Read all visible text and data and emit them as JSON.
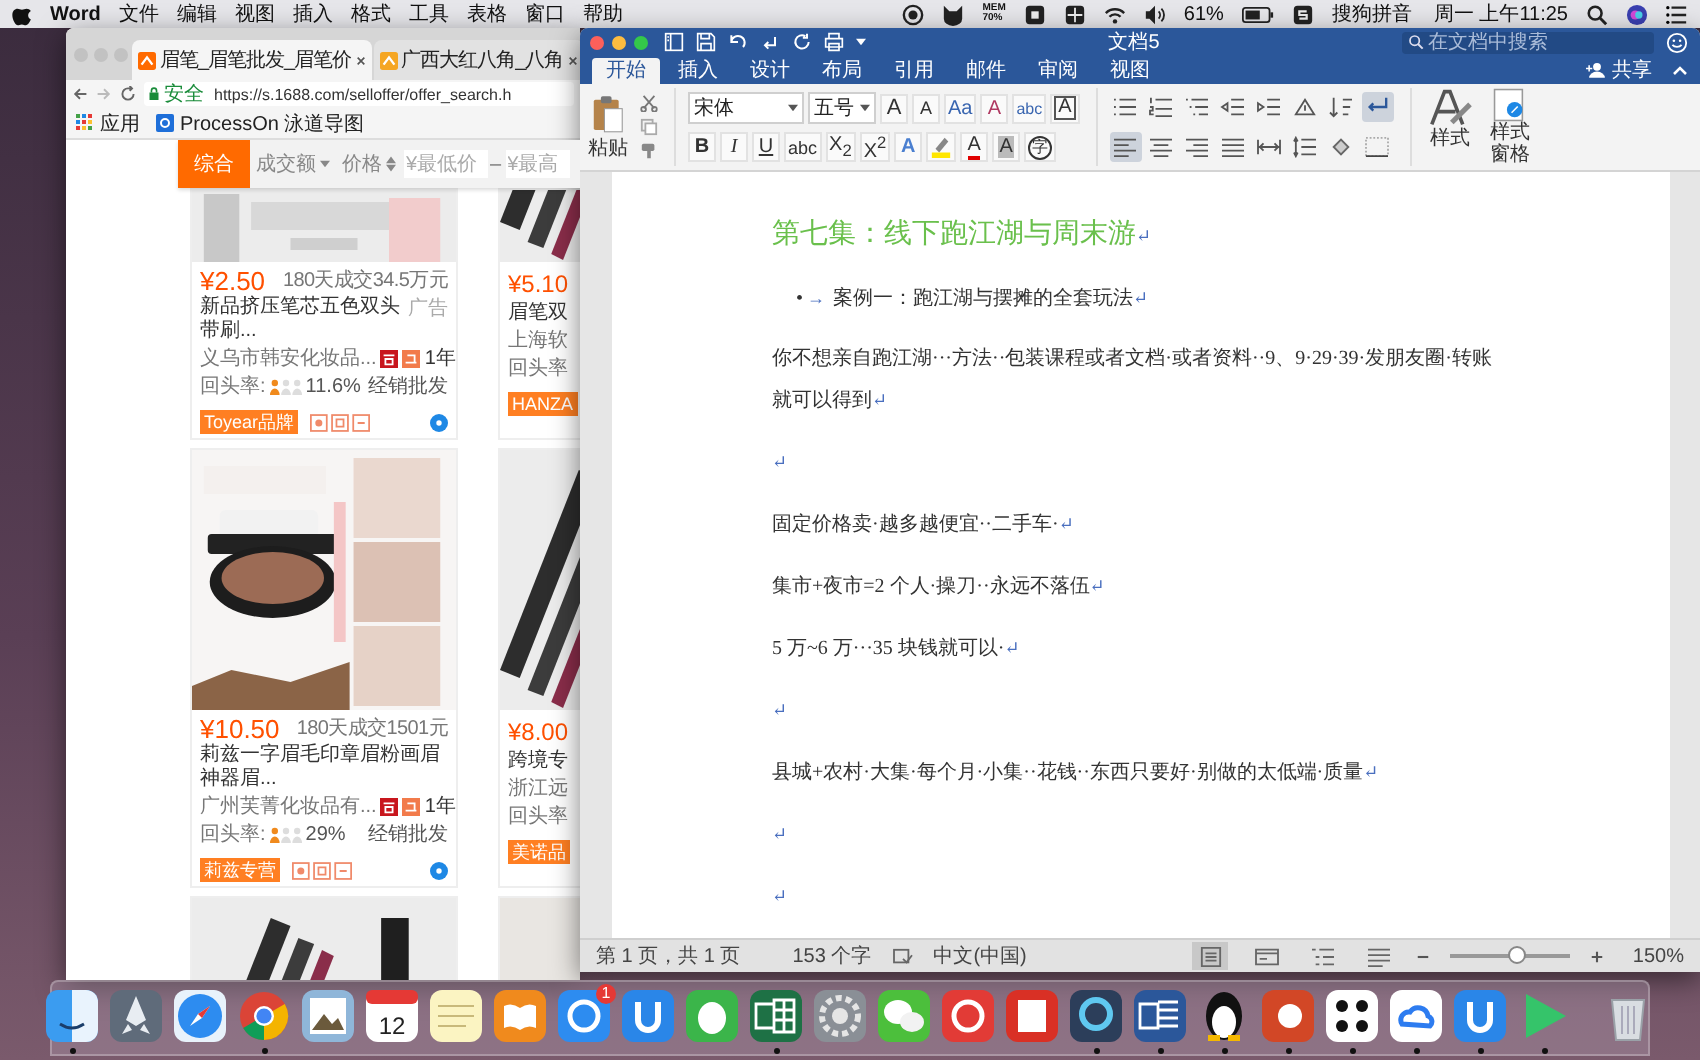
{
  "menubar": {
    "app": "Word",
    "menus": [
      "文件",
      "编辑",
      "视图",
      "插入",
      "格式",
      "工具",
      "表格",
      "窗口",
      "帮助"
    ],
    "memory_label": "MEM",
    "memory_value": "70%",
    "battery": "61%",
    "input_method": "搜狗拼音",
    "clock": "周一 上午11:25"
  },
  "browser": {
    "tabs": [
      {
        "title": "眉笔_眉笔批发_眉笔价",
        "selected": true
      },
      {
        "title": "广西大红八角_八角",
        "selected": false
      }
    ],
    "secure_label": "安全",
    "url": "https://s.1688.com/selloffer/offer_search.h",
    "bookmarks": [
      {
        "kind": "apps",
        "label": "应用"
      },
      {
        "kind": "site",
        "label": "ProcessOn 泳道导图"
      }
    ],
    "sort_options": [
      {
        "kind": "plain",
        "label": "综合",
        "selected": true
      },
      {
        "kind": "dropdown",
        "label": "成交额",
        "selected": false
      },
      {
        "kind": "toggle",
        "label": "价格",
        "selected": false
      }
    ],
    "price_min_placeholder": "¥最低价",
    "price_separator": "–",
    "price_max_placeholder": "¥最高",
    "products": [
      {
        "kind": "listing",
        "price": "¥2.50",
        "sales": "180天成交34.5万元",
        "title": "新品挤压笔芯五色双头带刷...",
        "ad": "广告",
        "company": "义乌市韩安化妆品...",
        "years": "1年",
        "repeat_label": "回头率:",
        "repeat_rate": "11.6%",
        "trade": "经销批发",
        "brand": "Toyear品牌"
      },
      {
        "kind": "partial",
        "price": "¥5.10",
        "title": "眉笔双",
        "company": "上海软",
        "repeat_label": "回头率",
        "brand": "HANZA"
      },
      {
        "kind": "listing",
        "price": "¥10.50",
        "sales": "180天成交1501元",
        "title": "莉兹一字眉毛印章眉粉画眉神器眉...",
        "company": "广州芙菁化妆品有...",
        "years": "1年",
        "repeat_label": "回头率:",
        "repeat_rate": "29%",
        "trade": "经销批发",
        "brand": "莉兹专营"
      },
      {
        "kind": "partial",
        "price": "¥8.00",
        "title": "跨境专",
        "company": "浙江远",
        "repeat_label": "回头率",
        "brand": "美诺品"
      },
      {
        "kind": "picture"
      },
      {
        "kind": "picture"
      }
    ]
  },
  "word": {
    "title": "文档5",
    "search_placeholder": "在文档中搜索",
    "tabs": [
      {
        "label": "开始",
        "selected": true
      },
      {
        "label": "插入",
        "selected": false
      },
      {
        "label": "设计",
        "selected": false
      },
      {
        "label": "布局",
        "selected": false
      },
      {
        "label": "引用",
        "selected": false
      },
      {
        "label": "邮件",
        "selected": false
      },
      {
        "label": "审阅",
        "selected": false
      },
      {
        "label": "视图",
        "selected": false
      }
    ],
    "share": "共享",
    "ribbon": {
      "paste": "粘贴",
      "font": "宋体",
      "size": "五号",
      "font_buttons": [
        {
          "kind": "grow",
          "label": "A"
        },
        {
          "kind": "shrink",
          "label": "A"
        },
        {
          "kind": "case",
          "label": "Aa"
        },
        {
          "kind": "clear",
          "label": "A"
        },
        {
          "kind": "phonetic",
          "label": "abc"
        },
        {
          "kind": "boxed",
          "label": "A"
        }
      ],
      "format_buttons": [
        {
          "kind": "bold",
          "label": "B"
        },
        {
          "kind": "italic",
          "label": "I"
        },
        {
          "kind": "underline",
          "label": "U"
        },
        {
          "kind": "strike",
          "label": "abc"
        },
        {
          "kind": "subscript",
          "label": "X$_{2}$"
        },
        {
          "kind": "superscript",
          "label": "X$^{2}$"
        },
        {
          "kind": "effects",
          "label": "A"
        },
        {
          "kind": "highlight"
        },
        {
          "kind": "color",
          "label": "A"
        },
        {
          "kind": "shade",
          "label": "A"
        },
        {
          "kind": "enclose",
          "label": "字"
        }
      ],
      "show_marks": true,
      "alignments": [
        {
          "kind": "left",
          "selected": true
        },
        {
          "kind": "center",
          "selected": false
        },
        {
          "kind": "right",
          "selected": false
        },
        {
          "kind": "justify",
          "selected": false
        },
        {
          "kind": "distribute",
          "selected": false
        }
      ],
      "styles": "样式",
      "styles_pane": "样式窗格"
    },
    "paragraphs": [
      {
        "kind": "heading",
        "text": "第七集：线下跑江湖与周末游",
        "mark": "↵"
      },
      {
        "kind": "bullet",
        "bullet": "•",
        "tab": "→",
        "text": "案例一：跑江湖与摆摊的全套玩法",
        "mark": "↵"
      },
      {
        "kind": "body",
        "text": "你不想亲自跑江湖···方法··包装课程或者文档·或者资料··9、9·29·39·发朋友圈·转账就可以得到",
        "mark": "↵"
      },
      {
        "kind": "empty",
        "mark": "↵"
      },
      {
        "kind": "body",
        "text": "固定价格卖·越多越便宜··二手车·",
        "mark": "↵"
      },
      {
        "kind": "body",
        "text": "集市+夜市=2 个人·操刀··永远不落伍",
        "mark": "↵"
      },
      {
        "kind": "body",
        "text": "5 万~6 万···35 块钱就可以·",
        "mark": "↵"
      },
      {
        "kind": "empty",
        "mark": "↵"
      },
      {
        "kind": "body",
        "text": "县城+农村·大集·每个月·小集··花钱··东西只要好·别做的太低端·质量",
        "mark": "↵"
      },
      {
        "kind": "empty",
        "mark": "↵"
      },
      {
        "kind": "empty",
        "mark": "↵"
      }
    ],
    "status": {
      "page": "第 1 页，共 1 页",
      "words": "153 个字",
      "language": "中文(中国)",
      "views": [
        {
          "kind": "print",
          "selected": true
        },
        {
          "kind": "web",
          "selected": false
        },
        {
          "kind": "outline",
          "selected": false
        },
        {
          "kind": "draft",
          "selected": false
        }
      ],
      "zoom_slider": {
        "level": 0.55
      },
      "zoom": "150%"
    }
  },
  "dock": {
    "badge": "1",
    "calendar_day": "12",
    "apps": [
      {
        "kind": "finder",
        "running": true
      },
      {
        "kind": "launchpad",
        "running": false
      },
      {
        "kind": "safari",
        "running": false
      },
      {
        "kind": "chrome",
        "running": true
      },
      {
        "kind": "preview",
        "running": false
      },
      {
        "kind": "calendar",
        "running": false
      },
      {
        "kind": "notes",
        "running": false
      },
      {
        "kind": "books",
        "running": false
      },
      {
        "kind": "appstore",
        "running": false
      },
      {
        "kind": "ushape",
        "running": false
      },
      {
        "kind": "evernote",
        "running": false
      },
      {
        "kind": "excel",
        "running": true
      },
      {
        "kind": "prefs",
        "running": false
      },
      {
        "kind": "wechat",
        "running": false
      },
      {
        "kind": "music",
        "running": false
      },
      {
        "kind": "pdf",
        "running": false
      },
      {
        "kind": "quicktime",
        "running": true
      },
      {
        "kind": "word",
        "running": true
      },
      {
        "kind": "qq",
        "running": true
      },
      {
        "kind": "ppt",
        "running": true
      },
      {
        "kind": "dots",
        "running": true
      },
      {
        "kind": "cloud",
        "running": true
      },
      {
        "kind": "ushape",
        "running": true
      },
      {
        "kind": "video",
        "running": true
      },
      {
        "kind": "trash",
        "running": false
      }
    ]
  }
}
